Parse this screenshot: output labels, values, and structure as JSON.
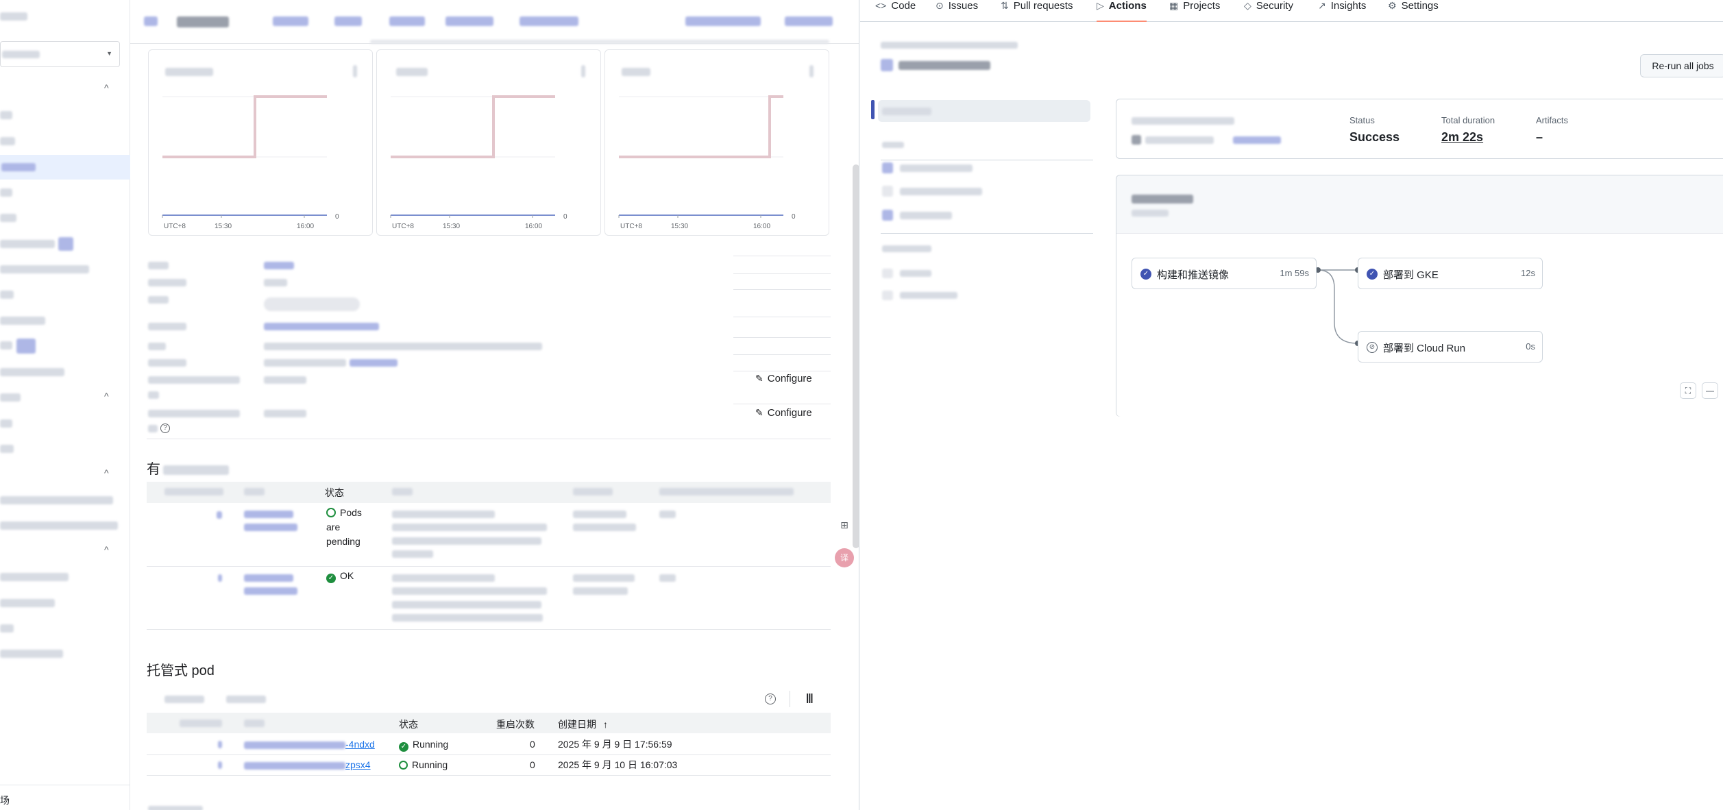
{
  "left_pane": {
    "sidebar": {
      "footer_label": "场",
      "chevron": "^"
    },
    "charts": [
      {
        "x_ticks": [
          "UTC+8",
          "15:30",
          "16:00"
        ],
        "zero_label": "0"
      },
      {
        "x_ticks": [
          "UTC+8",
          "15:30",
          "16:00"
        ],
        "zero_label": "0"
      },
      {
        "x_ticks": [
          "UTC+8",
          "15:30",
          "16:00"
        ],
        "zero_label": "0"
      }
    ],
    "configure_label": "Configure",
    "configure_label_2": "Configure",
    "help_glyph": "?",
    "revisions": {
      "title": "有",
      "status_header": "状态",
      "rows": [
        {
          "status_lines": [
            "Pods",
            "are",
            "pending"
          ]
        },
        {
          "status_lines": [
            "OK"
          ]
        }
      ]
    },
    "pods": {
      "title": "托管式 pod",
      "headers": {
        "status": "状态",
        "restarts": "重启次数",
        "created": "创建日期"
      },
      "sort_arrow": "↑",
      "rows": [
        {
          "name_suffix": "-4ndxd",
          "status": "Running",
          "restarts": "0",
          "created": "2025 年 9 月 9 日 17:56:59"
        },
        {
          "name_suffix": "zpsx4",
          "status": "Running",
          "restarts": "0",
          "created": "2025 年 9 月 10 日 16:07:03"
        }
      ]
    }
  },
  "right_pane": {
    "tabs": [
      {
        "label": "Code",
        "icon": "code-icon",
        "glyph": "<>"
      },
      {
        "label": "Issues",
        "icon": "issue-icon",
        "glyph": "⊙"
      },
      {
        "label": "Pull requests",
        "icon": "pull-request-icon",
        "glyph": "⇅"
      },
      {
        "label": "Actions",
        "icon": "play-icon",
        "glyph": "▷",
        "active": true
      },
      {
        "label": "Projects",
        "icon": "table-icon",
        "glyph": "▦"
      },
      {
        "label": "Security",
        "icon": "shield-icon",
        "glyph": "◇"
      },
      {
        "label": "Insights",
        "icon": "graph-icon",
        "glyph": "↗"
      },
      {
        "label": "Settings",
        "icon": "gear-icon",
        "glyph": "⚙"
      }
    ],
    "rerun_label": "Re-run all jobs",
    "summary": {
      "status_label": "Status",
      "status_value": "Success",
      "duration_label": "Total duration",
      "duration_value": "2m 22s",
      "artifacts_label": "Artifacts",
      "artifacts_value": "–"
    },
    "jobs": [
      {
        "name": "构建和推送镜像",
        "duration": "1m 59s",
        "state": "success"
      },
      {
        "name": "部署到 GKE",
        "duration": "12s",
        "state": "success"
      },
      {
        "name": "部署到 Cloud Run",
        "duration": "0s",
        "state": "skipped"
      }
    ],
    "colors": {
      "accent": "#4054b2",
      "tab_underline": "#fd8c73",
      "success": "#1e8e3e"
    }
  }
}
